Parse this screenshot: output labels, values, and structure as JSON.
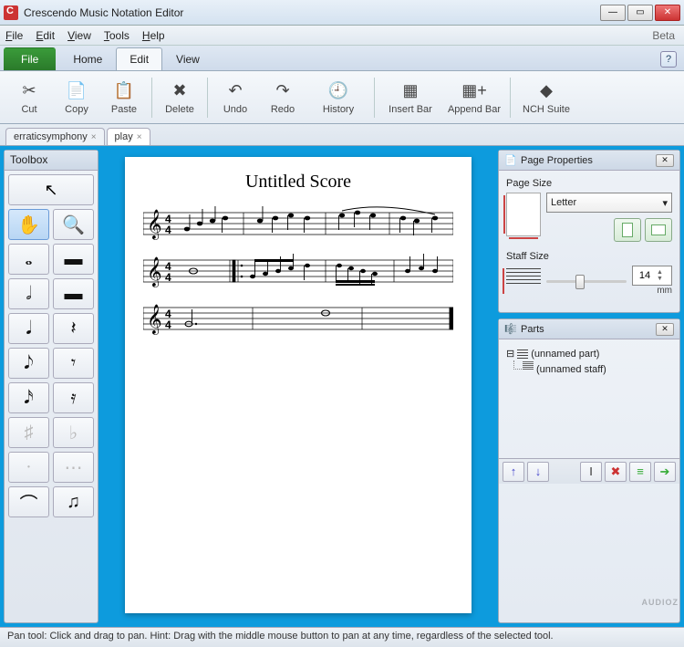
{
  "window": {
    "title": "Crescendo Music Notation Editor",
    "beta": "Beta"
  },
  "menubar": [
    "File",
    "Edit",
    "View",
    "Tools",
    "Help"
  ],
  "ribbon": {
    "tabs": [
      "File",
      "Home",
      "Edit",
      "View"
    ],
    "active": 2
  },
  "toolbar": [
    {
      "label": "Cut",
      "icon": "✂"
    },
    {
      "label": "Copy",
      "icon": "📄"
    },
    {
      "label": "Paste",
      "icon": "📋"
    },
    {
      "sep": true
    },
    {
      "label": "Delete",
      "icon": "✖"
    },
    {
      "sep": true
    },
    {
      "label": "Undo",
      "icon": "↶"
    },
    {
      "label": "Redo",
      "icon": "↷"
    },
    {
      "label": "History",
      "icon": "🕘"
    },
    {
      "sep": true
    },
    {
      "label": "Insert Bar",
      "icon": "▦"
    },
    {
      "label": "Append Bar",
      "icon": "▦+"
    },
    {
      "sep": true
    },
    {
      "label": "NCH Suite",
      "icon": "◆"
    }
  ],
  "docs": [
    {
      "name": "erraticsymphony",
      "active": false
    },
    {
      "name": "play",
      "active": true
    }
  ],
  "toolbox": {
    "title": "Toolbox",
    "pointer": "↖",
    "rows": [
      [
        "✋",
        "🔍"
      ],
      [
        "𝅝",
        "▬"
      ],
      [
        "𝅗𝅥",
        "▬"
      ],
      [
        "𝅘𝅥",
        "𝄽"
      ],
      [
        "𝅘𝅥𝅮",
        "𝄾"
      ],
      [
        "𝅘𝅥𝅯",
        "𝄿"
      ],
      [
        "♯",
        "♭"
      ],
      [
        "·",
        "⋯"
      ],
      [
        "⌒",
        "♫"
      ]
    ],
    "selected": [
      0,
      0
    ],
    "dimmed": [
      6,
      7
    ]
  },
  "score": {
    "title": "Untitled Score",
    "timesig": "4/4"
  },
  "page_props": {
    "title": "Page Properties",
    "size_label": "Page Size",
    "size_value": "Letter",
    "staff_label": "Staff Size",
    "staff_value": "14",
    "staff_unit": "mm"
  },
  "parts": {
    "title": "Parts",
    "items": [
      {
        "label": "(unnamed part)",
        "type": "part"
      },
      {
        "label": "(unnamed staff)",
        "type": "staff",
        "child": true
      }
    ],
    "buttons": [
      "↑",
      "↓",
      "I",
      "✖",
      "≡",
      "➔"
    ]
  },
  "status": "Pan tool: Click and drag to pan. Hint: Drag with the middle mouse button to pan at any time, regardless of the selected tool.",
  "watermark": "AUDIOZ"
}
